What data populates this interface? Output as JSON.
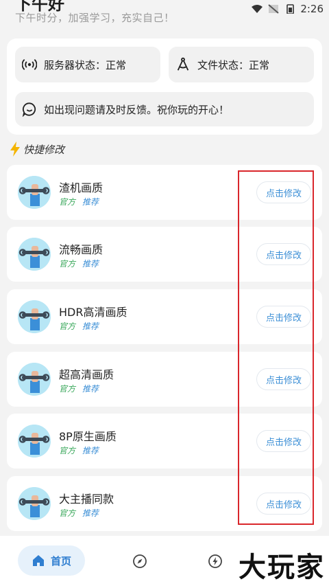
{
  "header": {
    "title": "下午好",
    "subtitle": "下午时分，加强学习，充实自己！"
  },
  "status_bar": {
    "time": "2:26"
  },
  "info": {
    "server_status": "服务器状态：正常",
    "file_status": "文件状态：正常",
    "feedback": "如出现问题请及时反馈。祝你玩的开心！"
  },
  "section": {
    "title": "快捷修改"
  },
  "items": [
    {
      "title": "渣机画质",
      "tag1": "官方",
      "tag2": "推荐",
      "button": "点击修改"
    },
    {
      "title": "流畅画质",
      "tag1": "官方",
      "tag2": "推荐",
      "button": "点击修改"
    },
    {
      "title": "HDR高清画质",
      "tag1": "官方",
      "tag2": "推荐",
      "button": "点击修改"
    },
    {
      "title": "超高清画质",
      "tag1": "官方",
      "tag2": "推荐",
      "button": "点击修改"
    },
    {
      "title": "8P原生画质",
      "tag1": "官方",
      "tag2": "推荐",
      "button": "点击修改"
    },
    {
      "title": "大主播同款",
      "tag1": "官方",
      "tag2": "推荐",
      "button": "点击修改"
    }
  ],
  "nav": {
    "home_label": "首页"
  },
  "watermark": "大玩家",
  "colors": {
    "accent": "#3c8fd6",
    "official": "#3aa85b",
    "highlight": "#d9262b"
  }
}
